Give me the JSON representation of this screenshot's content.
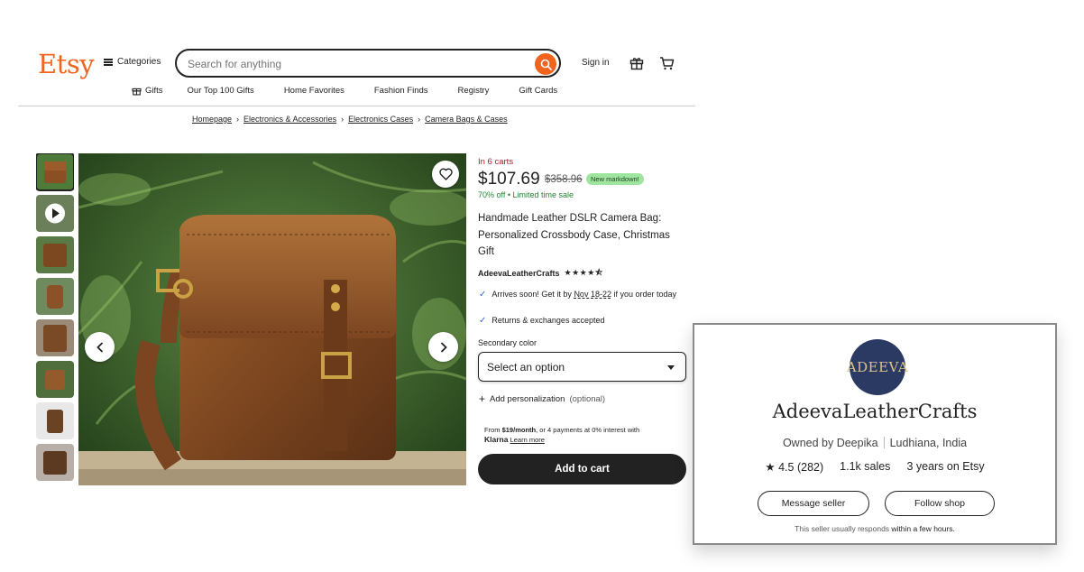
{
  "header": {
    "logo": "Etsy",
    "categories_label": "Categories",
    "search_placeholder": "Search for anything",
    "signin_label": "Sign in"
  },
  "nav": [
    {
      "label": "Gifts",
      "icon": "gift-icon"
    },
    {
      "label": "Our Top 100 Gifts"
    },
    {
      "label": "Home Favorites"
    },
    {
      "label": "Fashion Finds"
    },
    {
      "label": "Registry"
    },
    {
      "label": "Gift Cards"
    }
  ],
  "breadcrumb": [
    "Homepage",
    "Electronics & Accessories",
    "Electronics Cases",
    "Camera Bags & Cases"
  ],
  "product": {
    "in_carts": "In 6 carts",
    "price": "$107.69",
    "original_price": "$358.96",
    "markdown_badge": "New markdown!",
    "discount": "70% off",
    "discount_note": "Limited time sale",
    "title": "Handmade Leather DSLR Camera Bag: Personalized Crossbody Case, Christmas Gift",
    "shop": "AdeevaLeatherCrafts",
    "rating_stars": 4.5,
    "arrival_prefix": "Arrives soon! Get it by ",
    "arrival_date": "Nov 18-22",
    "arrival_suffix": " if you order today",
    "returns": "Returns & exchanges accepted",
    "secondary_color_label": "Secondary color",
    "select_value": "Select an option",
    "personalization_label": "Add personalization",
    "personalization_note": "(optional)",
    "klarna_from": "From ",
    "klarna_amount": "$19/month",
    "klarna_rest": ", or 4 payments at 0% interest with",
    "klarna_brand": "Klarna",
    "klarna_learn": "Learn more",
    "add_to_cart": "Add to cart"
  },
  "gallery": {
    "thumbnail_count": 8,
    "selected_index": 0
  },
  "seller_card": {
    "avatar_text": "ADEEVA",
    "shop_name": "AdeevaLeatherCrafts",
    "owner": "Owned by Deepika",
    "location": "Ludhiana, India",
    "rating": "4.5",
    "reviews": "(282)",
    "sales": "1.1k sales",
    "years": "3 years on Etsy",
    "message_button": "Message seller",
    "follow_button": "Follow shop",
    "responds_prefix": "This seller usually responds ",
    "responds_time": "within a few hours."
  },
  "colors": {
    "accent": "#f1641e",
    "carts_red": "#a61a2e",
    "sale_green": "#258635",
    "badge_green": "#9ee5a0",
    "leather_brown": "#8a4f22"
  }
}
